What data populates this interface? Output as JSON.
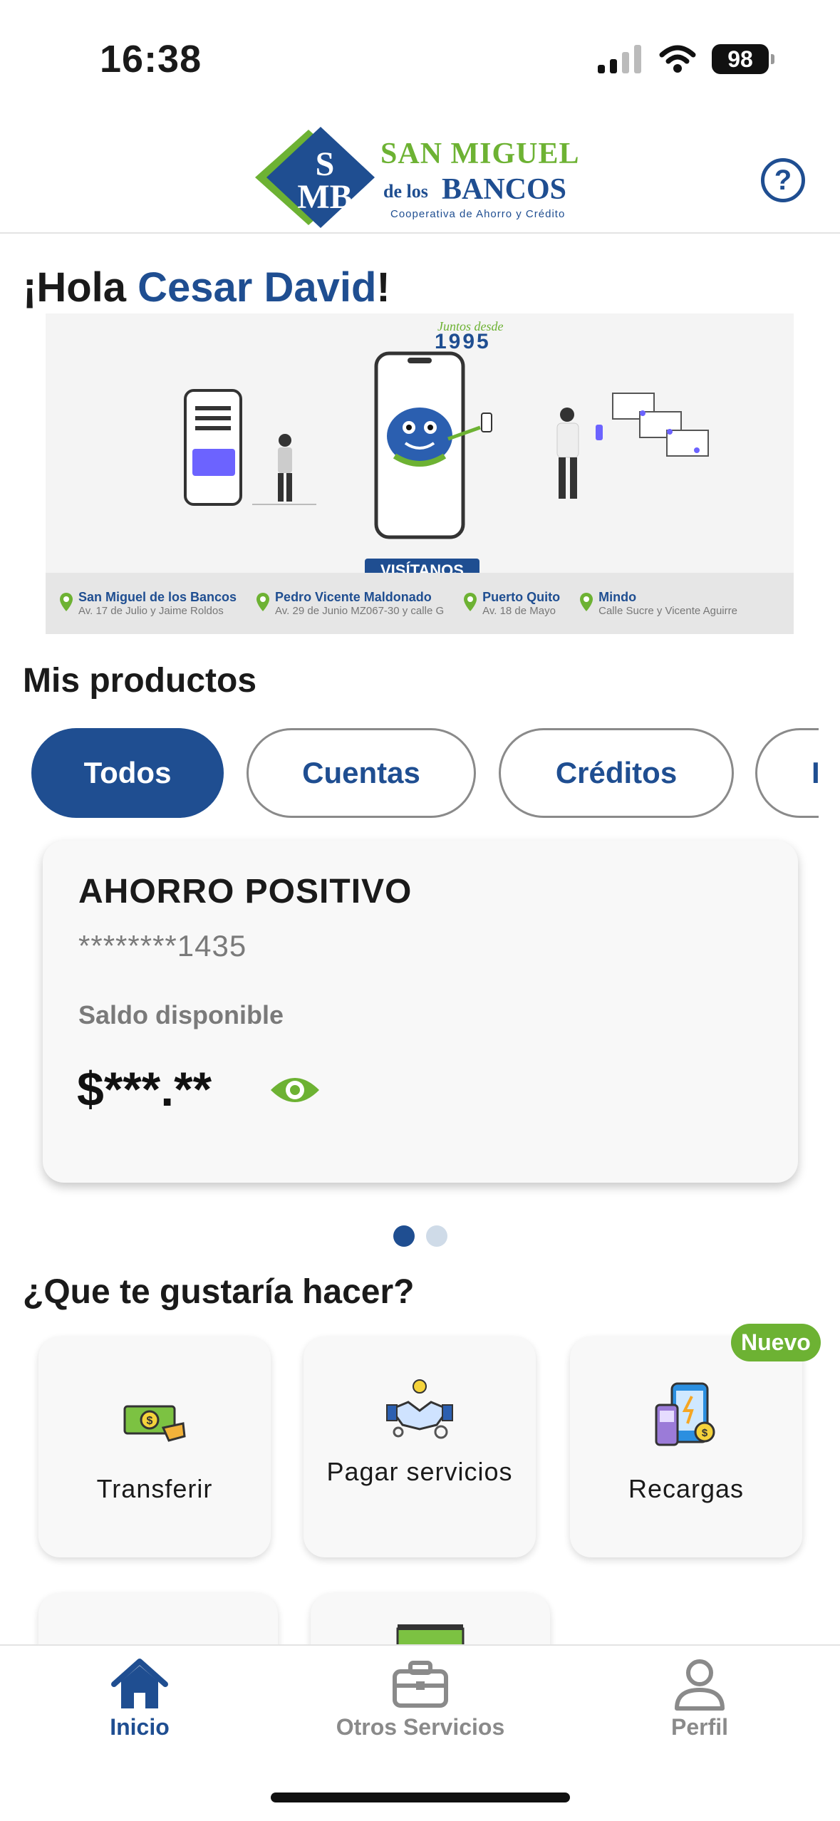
{
  "status": {
    "time": "16:38",
    "battery": "98"
  },
  "header": {
    "logo": {
      "line1": "SAN MIGUEL",
      "line2a": "de los",
      "line2b": "BANCOS",
      "line3": "Cooperativa de Ahorro y Crédito"
    },
    "help_label": "?"
  },
  "greeting": {
    "prefix": "¡Hola ",
    "name": "Cesar David",
    "suffix": "!"
  },
  "banner": {
    "since_text": "Juntos desde",
    "year": "1995",
    "cta": "VISÍTANOS",
    "branches": [
      {
        "name": "San Miguel de los Bancos",
        "address": "Av. 17 de Julio y Jaime Roldos"
      },
      {
        "name": "Pedro Vicente Maldonado",
        "address": "Av. 29 de Junio MZ067-30 y calle G"
      },
      {
        "name": "Puerto Quito",
        "address": "Av. 18 de Mayo"
      },
      {
        "name": "Mindo",
        "address": "Calle Sucre y Vicente Aguirre"
      }
    ]
  },
  "products": {
    "title": "Mis productos",
    "filters": [
      "Todos",
      "Cuentas",
      "Créditos",
      "I"
    ],
    "active_filter": "Todos",
    "card": {
      "name": "AHORRO POSITIVO",
      "account": "********1435",
      "balance_label": "Saldo disponible",
      "balance": "$***.**"
    },
    "pager": {
      "pages": 2,
      "current": 1
    }
  },
  "actions": {
    "title": "¿Que te gustaría hacer?",
    "items": [
      {
        "label": "Transferir",
        "icon": "money-transfer-icon"
      },
      {
        "label": "Pagar servicios",
        "icon": "handshake-services-icon"
      },
      {
        "label": "Recargas",
        "icon": "phone-recharge-icon",
        "badge": "Nuevo"
      }
    ]
  },
  "nav": {
    "items": [
      {
        "label": "Inicio",
        "icon": "home-icon",
        "active": true
      },
      {
        "label": "Otros Servicios",
        "icon": "briefcase-icon",
        "active": false
      },
      {
        "label": "Perfil",
        "icon": "user-icon",
        "active": false
      }
    ]
  },
  "colors": {
    "primary": "#1f4e91",
    "accent": "#6db233",
    "muted": "#8a8a8a"
  }
}
